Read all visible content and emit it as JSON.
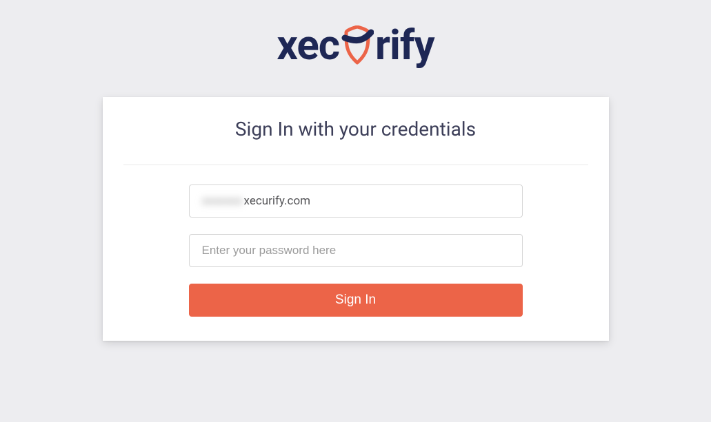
{
  "brand": {
    "text_left": "xec",
    "text_right": "rify"
  },
  "card": {
    "title": "Sign In with your credentials"
  },
  "form": {
    "email_prefix_redacted": "xxxxxxx",
    "email_domain": "xecurify.com",
    "password_placeholder": "Enter your password here",
    "submit_label": "Sign In"
  }
}
